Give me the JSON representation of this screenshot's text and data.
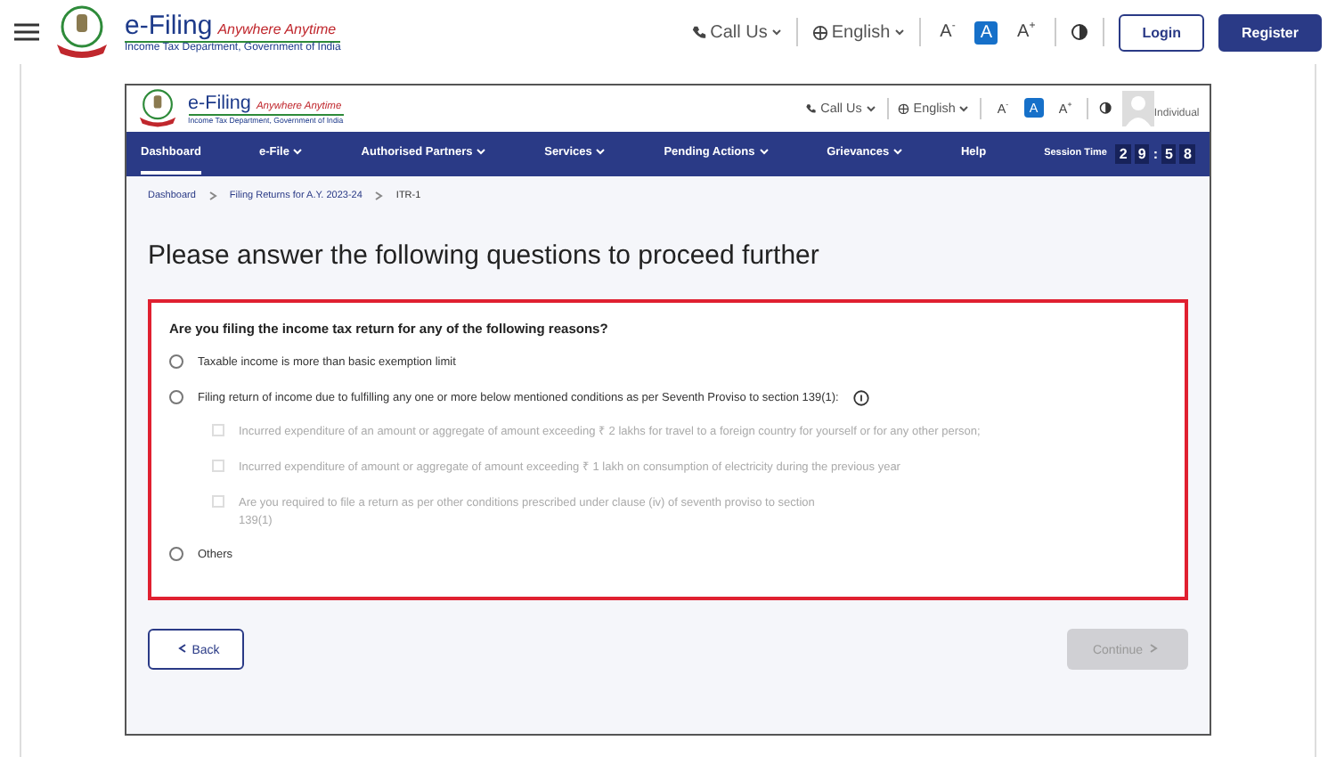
{
  "site_header": {
    "brand": "e-Filing",
    "tagline": "Anywhere Anytime",
    "department": "Income Tax Department, Government of India",
    "call_us": "Call Us",
    "language": "English",
    "font_sizes": [
      {
        "label": "A$^{-}$",
        "selected": false
      },
      {
        "label": "A",
        "selected": true
      },
      {
        "label": "A$^{+}$",
        "selected": false
      }
    ],
    "login": "Login",
    "register": "Register"
  },
  "screenshot": {
    "header": {
      "brand": "e-Filing",
      "tagline": "Anywhere Anytime",
      "department": "Income Tax Department, Government of India",
      "call_us": "Call Us",
      "language": "English",
      "font_sizes": [
        {
          "label": "A$^{-}$",
          "selected": false
        },
        {
          "label": "A",
          "selected": true
        },
        {
          "label": "A$^{+}$",
          "selected": false
        }
      ],
      "user": "Individual"
    },
    "nav": {
      "items": [
        {
          "label": "Dashboard",
          "selected": true,
          "dropdown": false
        },
        {
          "label": "e-File",
          "selected": false,
          "dropdown": true
        },
        {
          "label": "Authorised Partners",
          "selected": false,
          "dropdown": true
        },
        {
          "label": "Services",
          "selected": false,
          "dropdown": true
        },
        {
          "label": "Pending Actions",
          "selected": false,
          "dropdown": true
        },
        {
          "label": "Grievances",
          "selected": false,
          "dropdown": true
        },
        {
          "label": "Help",
          "selected": false,
          "dropdown": false
        }
      ],
      "session_label": "Session Time",
      "minutes": [
        "2",
        "9"
      ],
      "separator": ":",
      "seconds": [
        "5",
        "8"
      ]
    },
    "breadcrumb": [
      "Dashboard",
      "Filing Returns for A.Y. 2023-24",
      "ITR-1"
    ],
    "title": "Please answer the following questions to proceed further",
    "question": "Are you filing the income tax return for any of the following reasons?",
    "options": [
      {
        "label": "Taxable income is more than basic exemption limit",
        "selected": false,
        "info": false
      },
      {
        "label": "Filing return of income due to fulfilling any one or more below mentioned conditions as per Seventh Proviso to section 139(1):",
        "selected": false,
        "info": true,
        "children": [
          {
            "label": "Incurred expenditure of an amount or aggregate of amount exceeding ₹ 2 lakhs for travel to a foreign country for yourself or for any other person;",
            "checked": false,
            "disabled": true
          },
          {
            "label": "Incurred expenditure of amount or aggregate of amount exceeding ₹ 1 lakh on consumption of electricity during the previous year",
            "checked": false,
            "disabled": true
          },
          {
            "label": "Are you required to file a return as per other conditions prescribed under clause (iv) of seventh proviso to section 139(1)",
            "checked": false,
            "disabled": true
          }
        ]
      },
      {
        "label": "Others",
        "selected": false,
        "info": false
      }
    ],
    "back": "Back",
    "continue": {
      "label": "Continue",
      "disabled": true
    }
  }
}
